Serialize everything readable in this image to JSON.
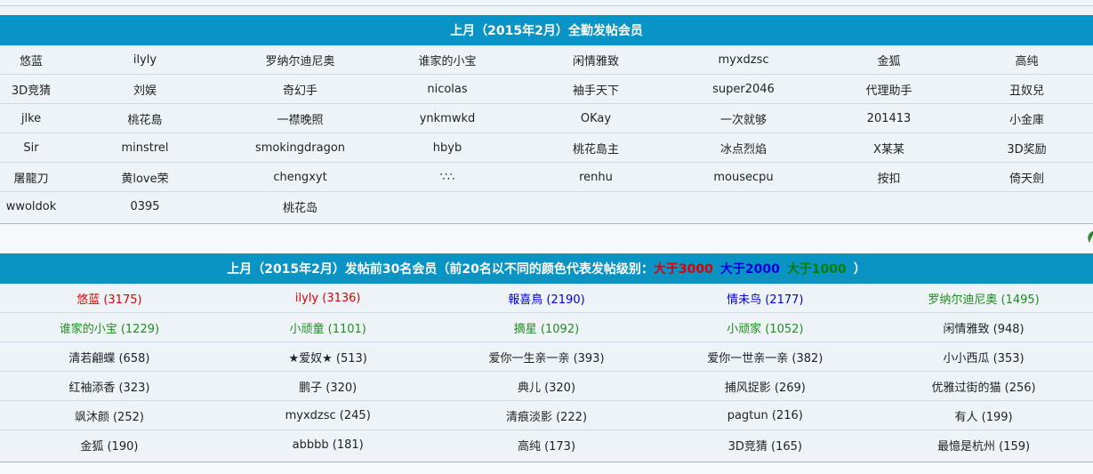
{
  "monthly_full_attendance": {
    "title": "上月（2015年2月）全勤发帖会员",
    "rows": [
      [
        "悠蓝",
        "ilyly",
        "罗纳尔迪尼奥",
        "谁家的小宝",
        "闲情雅致",
        "myxdzsc",
        "金狐",
        "高纯"
      ],
      [
        "3D竞猜",
        "刘娱",
        "奇幻手",
        "nicolas",
        "袖手天下",
        "super2046",
        "代理助手",
        "丑奴兒"
      ],
      [
        "jlke",
        "桃花島",
        "一襟晚照",
        "ynkmwkd",
        "OKay",
        "一次就够",
        "201413",
        "小金庫"
      ],
      [
        "Sir",
        "minstrel",
        "smokingdragon",
        "hbyb",
        "桃花島主",
        "冰点烈焰",
        "X某某",
        "3D奖励"
      ],
      [
        "屠龍刀",
        "黄love荣",
        "chengxyt",
        "∵∴",
        "renhu",
        "mousecpu",
        "按扣",
        "倚天劍"
      ],
      [
        "wwoldok",
        "0395",
        "桃花岛",
        "",
        "",
        "",
        "",
        ""
      ]
    ]
  },
  "top30": {
    "title_prefix": "上月（2015年2月）发帖前30名会员（前20名以不同的颜色代表发帖级别：",
    "legend": [
      {
        "label": "大于3000",
        "color": "#e00000"
      },
      {
        "label": "大于2000",
        "color": "#0000dd"
      },
      {
        "label": "大于1000",
        "color": "#008000"
      }
    ],
    "title_suffix": "）",
    "rows": [
      [
        {
          "t": "悠蓝 (3175)",
          "c": "#e00000"
        },
        {
          "t": "ilyly (3136)",
          "c": "#e00000"
        },
        {
          "t": "報喜鳥 (2190)",
          "c": "#0000dd"
        },
        {
          "t": "情未鸟 (2177)",
          "c": "#0000dd"
        },
        {
          "t": "罗纳尔迪尼奥 (1495)",
          "c": "#228b22"
        }
      ],
      [
        {
          "t": "谁家的小宝 (1229)",
          "c": "#228b22"
        },
        {
          "t": "小顽童 (1101)",
          "c": "#228b22"
        },
        {
          "t": "摘星 (1092)",
          "c": "#228b22"
        },
        {
          "t": "小顽家 (1052)",
          "c": "#228b22"
        },
        {
          "t": "闲情雅致 (948)",
          "c": "#222222"
        }
      ],
      [
        {
          "t": "清若翩蝶 (658)",
          "c": "#222222"
        },
        {
          "t": "★爱奴★ (513)",
          "c": "#222222"
        },
        {
          "t": "爱你一生亲一亲 (393)",
          "c": "#222222"
        },
        {
          "t": "爱你一世亲一亲 (382)",
          "c": "#222222"
        },
        {
          "t": "小小西瓜 (353)",
          "c": "#222222"
        }
      ],
      [
        {
          "t": "红袖添香 (323)",
          "c": "#222222"
        },
        {
          "t": "鹏子 (320)",
          "c": "#222222"
        },
        {
          "t": "典儿 (320)",
          "c": "#222222"
        },
        {
          "t": "捕风捉影 (269)",
          "c": "#222222"
        },
        {
          "t": "优雅过街的猫 (256)",
          "c": "#222222"
        }
      ],
      [
        {
          "t": "飒沐颜 (252)",
          "c": "#222222"
        },
        {
          "t": "myxdzsc (245)",
          "c": "#222222"
        },
        {
          "t": "清痕淡影 (222)",
          "c": "#222222"
        },
        {
          "t": "pagtun (216)",
          "c": "#222222"
        },
        {
          "t": "有人 (199)",
          "c": "#222222"
        }
      ],
      [
        {
          "t": "金狐 (190)",
          "c": "#222222"
        },
        {
          "t": "abbbb (181)",
          "c": "#222222"
        },
        {
          "t": "高纯 (173)",
          "c": "#222222"
        },
        {
          "t": "3D竞猜 (165)",
          "c": "#222222"
        },
        {
          "t": "最憶是杭州 (159)",
          "c": "#222222"
        }
      ]
    ]
  },
  "colors": {
    "header_bg": "#0a94c5",
    "panel_bg": "#eef3f8"
  }
}
